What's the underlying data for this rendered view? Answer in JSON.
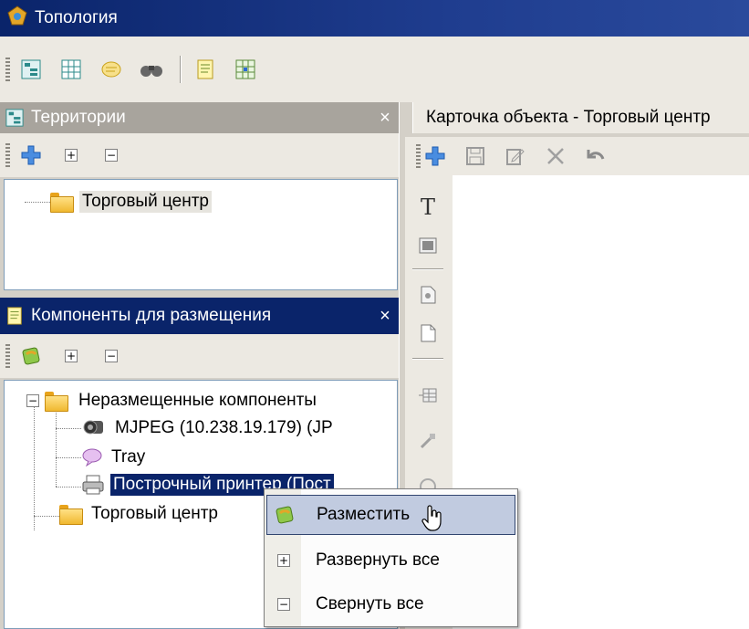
{
  "window": {
    "title": "Топология"
  },
  "main_toolbar": {
    "icons": [
      "territories-icon",
      "grid-icon",
      "notes-icon",
      "binoculars-icon",
      "document-icon",
      "matrix-icon"
    ]
  },
  "territories_panel": {
    "title": "Территории",
    "close": "×",
    "tree": [
      {
        "label": "Торговый центр",
        "type": "folder"
      }
    ]
  },
  "components_panel": {
    "title": "Компоненты для размещения",
    "close": "×",
    "tree": {
      "group1": "Неразмещенные компоненты",
      "children": [
        "MJPEG (10.238.19.179) (JP",
        "Tray",
        "Построчный принтер (Пост"
      ],
      "group2": "Торговый центр"
    }
  },
  "object_card": {
    "tab_title": "Карточка объекта - Торговый центр"
  },
  "context_menu": {
    "items": [
      {
        "label": "Разместить",
        "icon": "place-icon",
        "highlighted": true
      },
      {
        "label": "Развернуть все",
        "icon": "expand-icon"
      },
      {
        "label": "Свернуть все",
        "icon": "collapse-icon"
      }
    ]
  },
  "expand_glyph": "+",
  "collapse_glyph": "−",
  "text_tool_glyph": "T",
  "colors": {
    "title_active": "#0a246a",
    "header_inactive": "#a8a49d",
    "menu_highlight": "#c1cbe0"
  }
}
